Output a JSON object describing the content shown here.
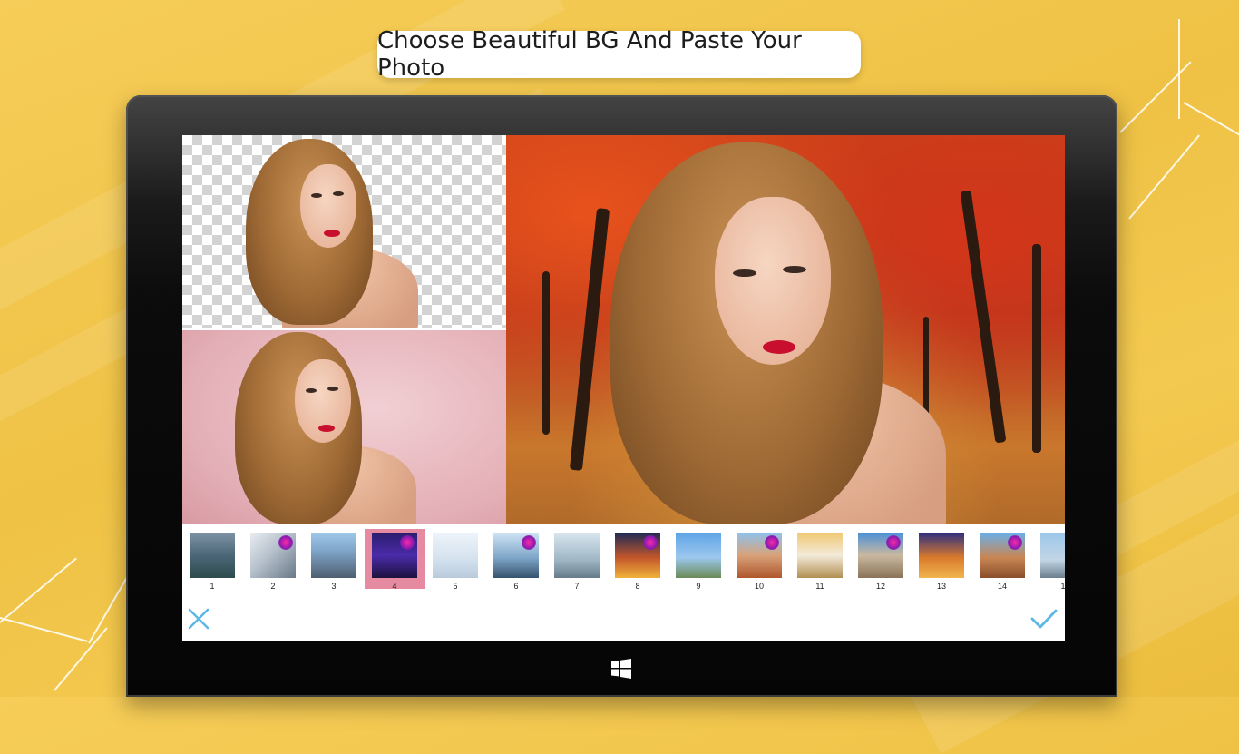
{
  "headline": {
    "text": "Choose Beautiful BG And Paste Your Photo"
  },
  "colors": {
    "background": "#f1c64b",
    "tablet_bezel": "#0a0a0a",
    "selection": "#e58aa0",
    "accent_icons": "#5bb8e6"
  },
  "gallery": {
    "selected_index": 4,
    "thumbnails": [
      {
        "number": "1"
      },
      {
        "number": "2"
      },
      {
        "number": "3"
      },
      {
        "number": "4"
      },
      {
        "number": "5"
      },
      {
        "number": "6"
      },
      {
        "number": "7"
      },
      {
        "number": "8"
      },
      {
        "number": "9"
      },
      {
        "number": "10"
      },
      {
        "number": "11"
      },
      {
        "number": "12"
      },
      {
        "number": "13"
      },
      {
        "number": "14"
      },
      {
        "number": "1"
      }
    ]
  },
  "icons": {
    "cancel": "close-icon",
    "confirm": "checkmark-icon",
    "home": "windows-logo-icon"
  }
}
